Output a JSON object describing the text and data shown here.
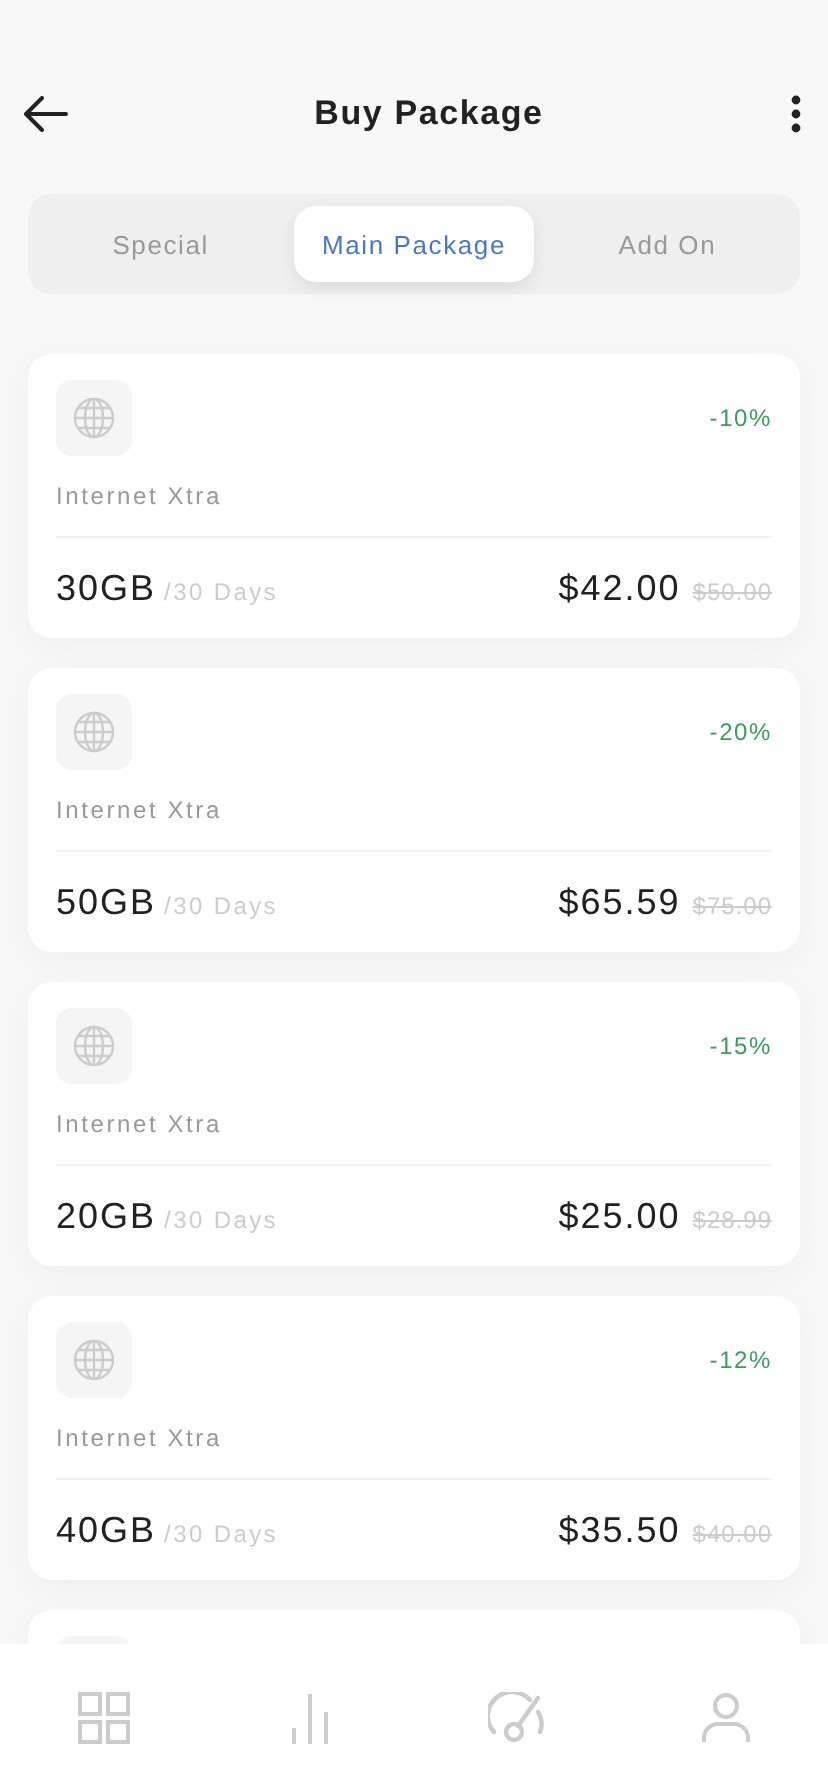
{
  "header": {
    "title": "Buy Package"
  },
  "tabs": [
    {
      "label": "Special",
      "selected": false
    },
    {
      "label": "Main Package",
      "selected": true
    },
    {
      "label": "Add On",
      "selected": false
    }
  ],
  "packages": [
    {
      "discount": "-10%",
      "name": "Internet Xtra",
      "quota": "30GB",
      "period": "/30 Days",
      "price": "$42.00",
      "old_price": "$50.00"
    },
    {
      "discount": "-20%",
      "name": "Internet Xtra",
      "quota": "50GB",
      "period": "/30 Days",
      "price": "$65.59",
      "old_price": "$75.00"
    },
    {
      "discount": "-15%",
      "name": "Internet Xtra",
      "quota": "20GB",
      "period": "/30 Days",
      "price": "$25.00",
      "old_price": "$28.99"
    },
    {
      "discount": "-12%",
      "name": "Internet Xtra",
      "quota": "40GB",
      "period": "/30 Days",
      "price": "$35.50",
      "old_price": "$40.00"
    }
  ]
}
